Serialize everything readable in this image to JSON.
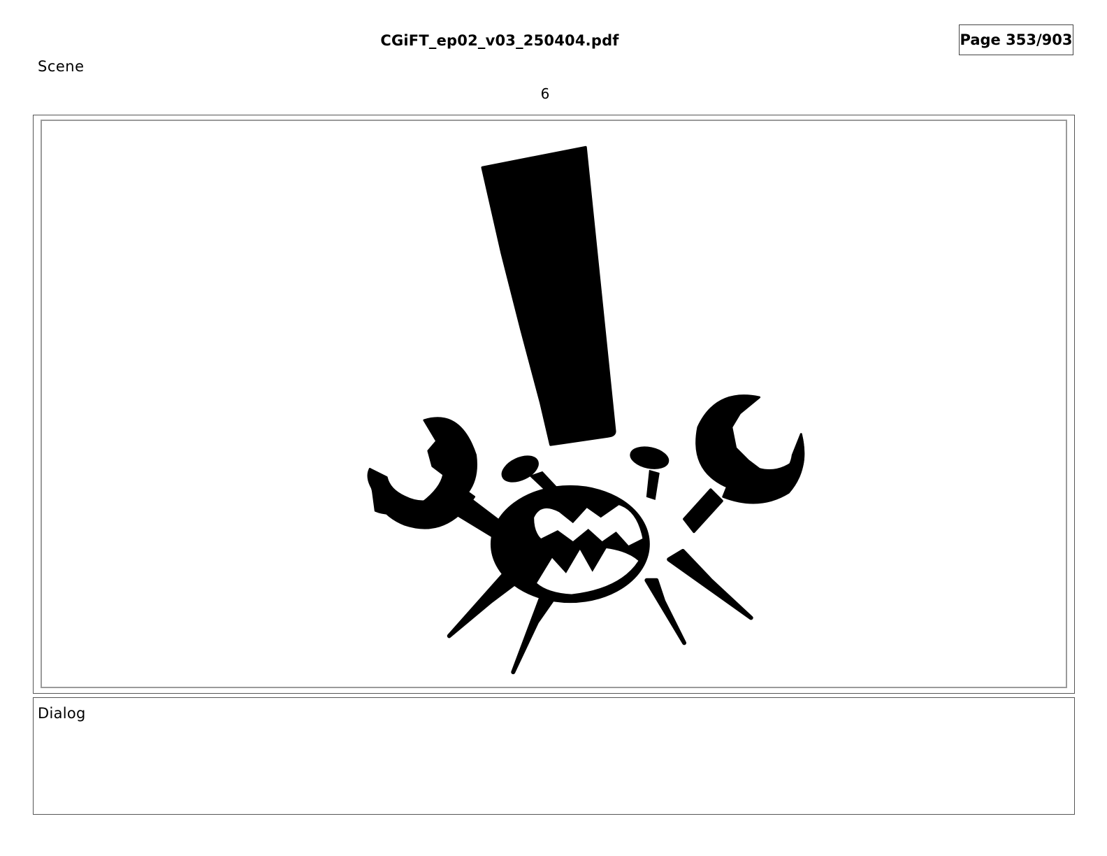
{
  "header": {
    "filename": "CGiFT_ep02_v03_250404.pdf",
    "page_indicator": "Page 353/903"
  },
  "scene": {
    "label": "Scene",
    "number": "6"
  },
  "panel": {
    "artwork": "crab-exclamation-illustration"
  },
  "dialog": {
    "label": "Dialog",
    "text": ""
  },
  "colors": {
    "ink": "#000000",
    "panel_border": "#9a9a9a",
    "frame_border": "#555555",
    "background": "#ffffff"
  }
}
